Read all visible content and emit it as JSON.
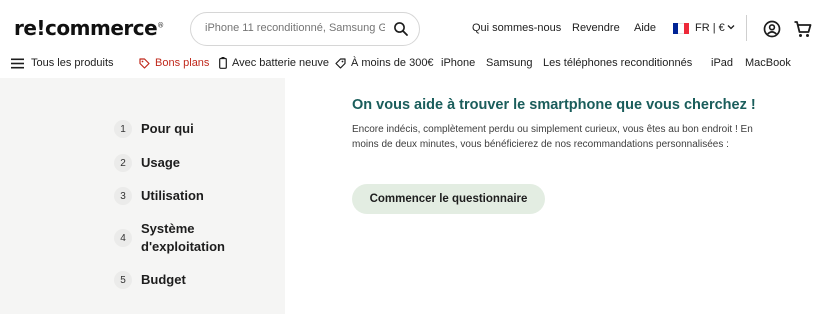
{
  "header": {
    "logo": "re!commerce",
    "logo_mark": "®",
    "search": {
      "placeholder": "iPhone 11 reconditionné, Samsung G..."
    },
    "links": [
      "Qui sommes-nous",
      "Revendre",
      "Aide"
    ],
    "locale": "FR | €",
    "flag_colors": [
      "#002395",
      "#ffffff",
      "#ed2939"
    ]
  },
  "nav": {
    "all_products": "Tous les produits",
    "items": [
      {
        "label": "Bons plans",
        "icon": "tag-icon",
        "color": "#c0291c"
      },
      {
        "label": "Avec batterie neuve",
        "icon": "battery-icon"
      },
      {
        "label": "À moins de 300€",
        "icon": "price-tag-icon"
      },
      {
        "label": "iPhone"
      },
      {
        "label": "Samsung"
      },
      {
        "label": "Les téléphones reconditionnés"
      },
      {
        "label": "iPad"
      },
      {
        "label": "MacBook"
      }
    ]
  },
  "steps": [
    {
      "num": "1",
      "label": "Pour qui"
    },
    {
      "num": "2",
      "label": "Usage"
    },
    {
      "num": "3",
      "label": "Utilisation"
    },
    {
      "num": "4",
      "label": "Système d'exploitation"
    },
    {
      "num": "5",
      "label": "Budget"
    }
  ],
  "main": {
    "heading": "On vous aide à trouver le smartphone que vous cherchez !",
    "paragraph": "Encore indécis, complètement perdu ou simplement curieux, vous êtes au bon endroit ! En moins de deux minutes, vous bénéficierez de nos recommandations personnalisées :",
    "cta": "Commencer le questionnaire"
  },
  "colors": {
    "accent": "#1a5d5b",
    "cta_bg": "#e3ede2",
    "promo": "#c0291c",
    "sidebar_bg": "#f5f5f4"
  }
}
